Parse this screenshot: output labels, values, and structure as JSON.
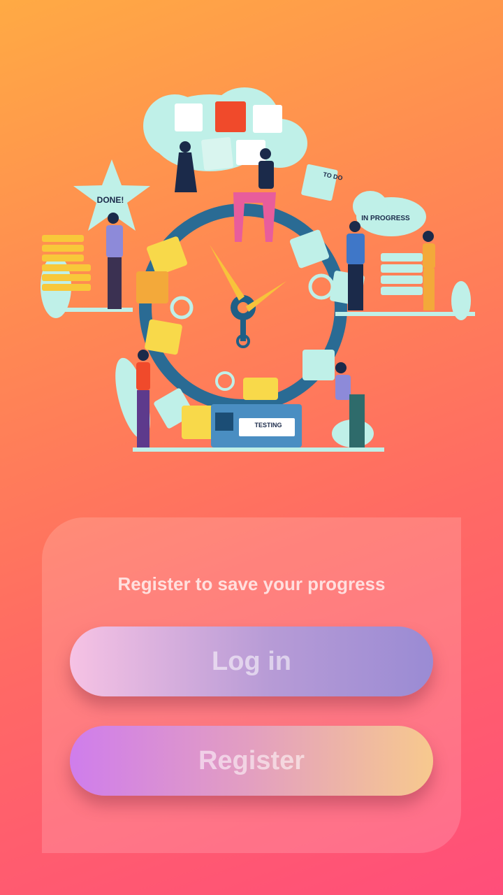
{
  "illustration": {
    "done_label": "DONE!",
    "todo_label": "TO DO",
    "in_progress_label": "IN PROGRESS",
    "testing_label": "TESTING"
  },
  "auth": {
    "tagline": "Register to save your progress",
    "login_label": "Log in",
    "register_label": "Register"
  }
}
